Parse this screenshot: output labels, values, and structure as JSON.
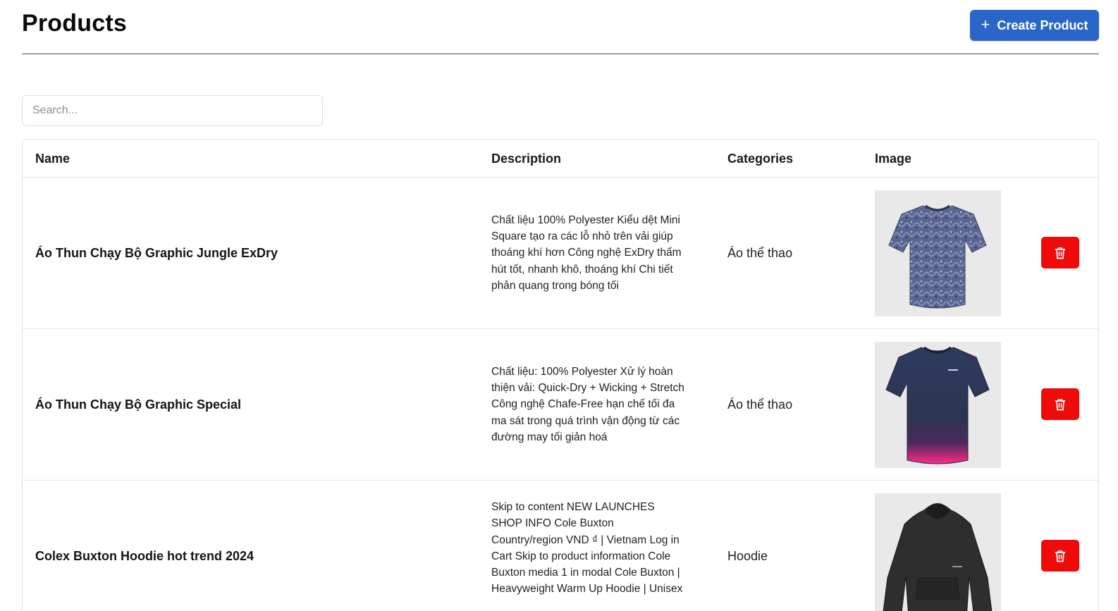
{
  "header": {
    "title": "Products",
    "create_label": "Create Product",
    "create_icon": "plus-icon"
  },
  "search": {
    "placeholder": "Search..."
  },
  "table": {
    "columns": {
      "name": "Name",
      "description": "Description",
      "categories": "Categories",
      "image": "Image"
    },
    "rows": [
      {
        "name": "Áo Thun Chạy Bộ Graphic Jungle ExDry",
        "description": "Chất liệu 100% Polyester Kiểu dệt Mini Square tạo ra các lỗ nhỏ trên vải giúp thoáng khí hơn Công nghệ ExDry thấm hút tốt, nhanh khô, thoáng khí Chi tiết phản quang trong bóng tối",
        "category": "Áo thể thao",
        "image_icon": "tshirt-jungle-image"
      },
      {
        "name": "Áo Thun Chạy Bộ Graphic Special",
        "description": "Chất liệu: 100% Polyester Xử lý hoàn thiện vải: Quick-Dry + Wicking + Stretch Công nghệ Chafe-Free hạn chế tối đa ma sát trong quá trình vận động từ các đường may tối giản hoá",
        "category": "Áo thể thao",
        "image_icon": "tshirt-special-image"
      },
      {
        "name": "Colex Buxton Hoodie hot trend 2024",
        "description": "Skip to content NEW LAUNCHES SHOP INFO Cole Buxton Country/region VND ₫ | Vietnam Log in Cart Skip to product information Cole Buxton media 1 in modal Cole Buxton | Heavyweight Warm Up Hoodie | Unisex",
        "category": "Hoodie",
        "image_icon": "hoodie-image"
      }
    ]
  },
  "colors": {
    "primary": "#2a66c9",
    "danger": "#f00b0b",
    "border": "#e3e6ea"
  },
  "icons": {
    "delete": "trash-icon"
  }
}
